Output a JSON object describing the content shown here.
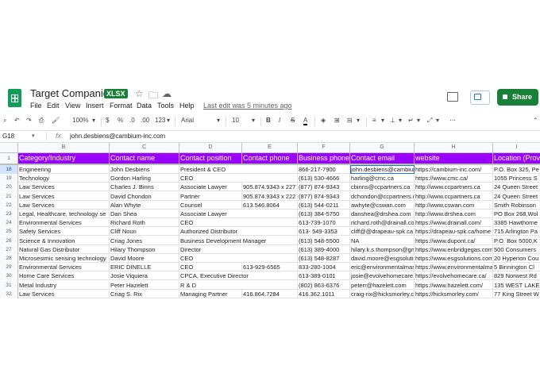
{
  "doc": {
    "title": "Target Companies",
    "badge": "XLSX",
    "menus": [
      "File",
      "Edit",
      "View",
      "Insert",
      "Format",
      "Data",
      "Tools",
      "Help"
    ],
    "last_edit": "Last edit was 5 minutes ago",
    "share_label": "Share"
  },
  "toolbar": {
    "zoom": "100%",
    "currency": "$",
    "percent": "%",
    "dec_decrease": ".0",
    "dec_increase": ".00",
    "more_formats": "123",
    "font": "Arial",
    "font_size": "10",
    "bold": "B",
    "italic": "I",
    "strike": "S",
    "text_color": "A"
  },
  "formula_bar": {
    "cell_ref": "G18",
    "fx": "fx",
    "value": "john.desbiens@cambium-inc.com"
  },
  "sheet": {
    "columns": [
      "B",
      "C",
      "D",
      "E",
      "F",
      "G",
      "H",
      "I"
    ],
    "header_row_num": "1",
    "headers": [
      "Category/Industry",
      "Contact name",
      "Contact position",
      "Contact phone",
      "Business phone",
      "Contact email",
      "website",
      "Location (Prov"
    ],
    "rows": [
      {
        "num": "18",
        "cells": [
          "Engineering",
          "John Desbiens",
          "President & CEO",
          "",
          "866-217-7900",
          "john.desbiens@cambium-inc.com",
          "https://cambium-inc.com/",
          "P.O. Box 325, Pe"
        ]
      },
      {
        "num": "19",
        "cells": [
          "Technology",
          "Gordon Harling",
          "CEO",
          "",
          "(613) 530-4666",
          "harling@cmc.ca",
          "https://www.cmc.ca/",
          "1055 Princess S"
        ]
      },
      {
        "num": "20",
        "cells": [
          "Law Services",
          "Charles J. Binns",
          "Associate Lawyer",
          "905.874.9343 x 227",
          "(877) 874-9343",
          "cbinns@ccpartners.ca",
          "http://www.ccpartners.ca",
          "24 Queen Street"
        ]
      },
      {
        "num": "21",
        "cells": [
          "Law Services",
          "David Chondon",
          "Partner",
          "905.874.9343 x 222",
          "(877) 874-9343",
          "dchondon@ccpartners.ca",
          "http://www.ccpartners.ca",
          "24 Queen Street"
        ]
      },
      {
        "num": "22",
        "cells": [
          "Law Services",
          "Alan Whyte",
          "Counsel",
          "613.546.8064",
          "(613) 544-0211",
          "awhyte@cswan.com",
          "http://www.cswan.com",
          "Smith Robinson"
        ]
      },
      {
        "num": "23",
        "cells": [
          "Legal, Healthcare, technology se",
          "Dan Shea",
          "Associate Lawyer",
          "",
          "(613) 384-5750",
          "danshea@drshea.com",
          "http://www.drshea.com",
          "PO Box 268,Wol"
        ]
      },
      {
        "num": "24",
        "cells": [
          "Environmental Services",
          "Richard Roth",
          "CEO",
          "",
          "613-739-1070",
          "richard.roth@drainall.com",
          "https://www.drainall.com/",
          "3385 Hawthorne"
        ]
      },
      {
        "num": "25",
        "cells": [
          "Safety Services",
          "Cliff Noun",
          "Authorized Distributor",
          "",
          "613- 549-3353",
          "cliff@@drapeau-spk.ca",
          "https://drapeau-spk.ca/home",
          "715 Arlington Pa"
        ]
      },
      {
        "num": "26",
        "cells": [
          "Science & Innovation",
          "Criag Jones",
          "Business Development Manager",
          "",
          "(613) 548-5500",
          "NA",
          "https://www.dupont.ca/",
          "P.O. Box 5000,K"
        ]
      },
      {
        "num": "27",
        "cells": [
          "Natural Gas Distributor",
          "Hilary Thompson",
          "Director",
          "",
          "(613) 389-4000",
          "hilary.k.s.thompson@gmail.com",
          "https://www.enbridgegas.com",
          "500 Consumers"
        ]
      },
      {
        "num": "28",
        "cells": [
          "Microsesimic sensing technology",
          "David Moore",
          "CEO",
          "",
          "(613) 548-8287",
          "david.moore@esgsolutions.com",
          "https://www.esgsolutions.com",
          "20 Hyperion Cou"
        ]
      },
      {
        "num": "29",
        "cells": [
          "Environmental Services",
          "ERIC DINELLE",
          "CEO",
          "613-929-6565",
          "833-280-1004",
          "eric@environmentalmaster.ca",
          "https://www.environmentalmaster.ca",
          "5 Binnington Cl"
        ]
      },
      {
        "num": "30",
        "cells": [
          "Home Care Services",
          "Josie Viquiera",
          "CPCA, Executive Director",
          "",
          "613-389-0101",
          "josie@evolvehomecare.ca",
          "https://evolvehomecare.ca/",
          "829 Norwest Rd"
        ]
      },
      {
        "num": "31",
        "cells": [
          "Metal Industry",
          "Peter Hazelett",
          "R & D",
          "",
          "(802) 863-6376",
          "peterr@hazelett.com",
          "https://www.hazelett.com/",
          "135 WEST LAKE"
        ]
      },
      {
        "num": "32",
        "cells": [
          "Law Services",
          "Criag S. Rix",
          "Managing Partner",
          "416.864.7284",
          "416.362.1011",
          "craig-rix@hicksmorley.com",
          "https://hicksmorley.com/",
          "77 King Street W"
        ]
      }
    ]
  },
  "colors": {
    "header_fill": "#9900ff",
    "share_button": "#188038",
    "selection": "#1a73e8"
  }
}
